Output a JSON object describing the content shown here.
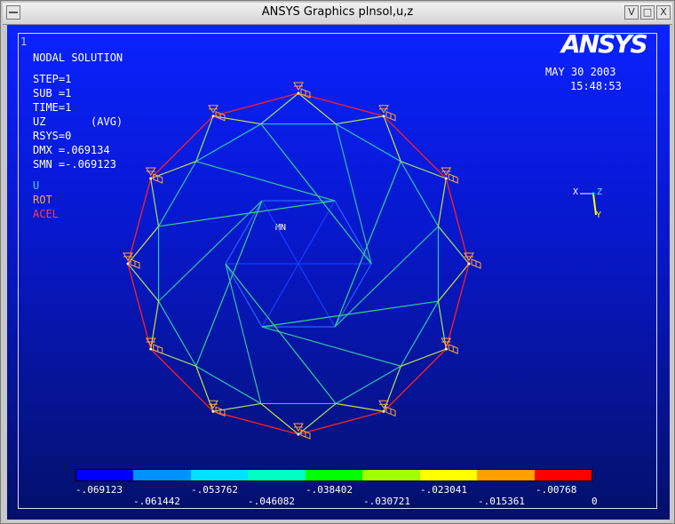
{
  "window": {
    "title": "ANSYS Graphics     plnsol,u,z",
    "buttons": [
      "V",
      "□",
      "X"
    ]
  },
  "viewport": {
    "number": "1",
    "logo": "ANSYS"
  },
  "info": [
    "NODAL SOLUTION",
    "STEP=1",
    "SUB =1",
    "TIME=1",
    "UZ       (AVG)",
    "RSYS=0",
    "DMX =.069134",
    "SMN =-.069123"
  ],
  "labels": {
    "u": "U",
    "rot": "ROT",
    "acel": "ACEL",
    "mn": "MN"
  },
  "date": "MAY 30 2003",
  "time": "15:48:53",
  "triad": {
    "x": "X",
    "y": "Y",
    "z": "Z"
  },
  "legend": {
    "colors": [
      "#0000ff",
      "#0090ff",
      "#00e0ff",
      "#00ffc0",
      "#00ff00",
      "#a0ff00",
      "#ffff00",
      "#ffa000",
      "#ff0000"
    ],
    "top_values": [
      "-.069123",
      "-.053762",
      "-.038402",
      "-.023041",
      "-.00768"
    ],
    "bottom_values": [
      "-.061442",
      "-.046082",
      "-.030721",
      "-.015361",
      "0"
    ]
  },
  "colors": {
    "outer_edge": "#ff2020",
    "support_symbol": "#ffa640",
    "support_x": "#ffffff"
  }
}
